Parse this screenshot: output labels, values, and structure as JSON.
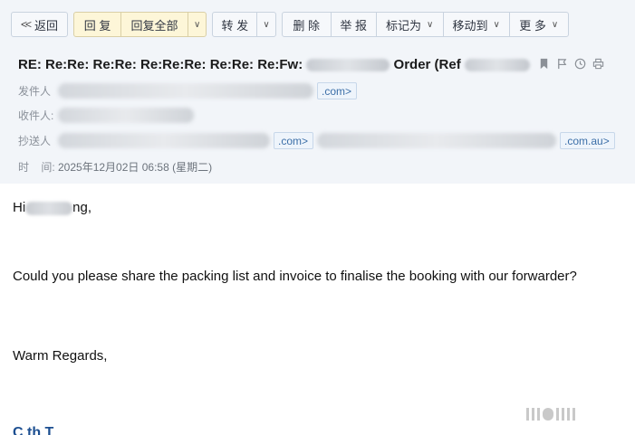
{
  "toolbar": {
    "back": "返回",
    "reply": "回 复",
    "reply_all": "回复全部",
    "forward": "转 发",
    "delete": "删 除",
    "report": "举 报",
    "mark_as": "标记为",
    "move_to": "移动到",
    "more": "更 多"
  },
  "header": {
    "subject_prefix": "RE: Re:Re: Re:Re: Re:Re:Re: Re:Re: Re:Fw:",
    "subject_mid": "Order (Ref",
    "icons": [
      "bookmark-icon",
      "flag-icon",
      "clock-icon",
      "print-icon"
    ]
  },
  "meta": {
    "from_label": "发件人",
    "from_suffix": ".com>",
    "to_label": "收件人:",
    "cc_label": "抄送人",
    "cc_suffix_1": ".com>",
    "cc_suffix_2": ".com.au>",
    "time_label": "时    间:",
    "time_value": "2025年12月02日 06:58 (星期二)"
  },
  "body": {
    "greeting_start": "Hi",
    "greeting_end": "ng,",
    "request": "Could you please share the packing list and invoice to finalise the booking with our forwarder?",
    "closing": "Warm Regards,",
    "signature_partial": "C  th  T"
  }
}
